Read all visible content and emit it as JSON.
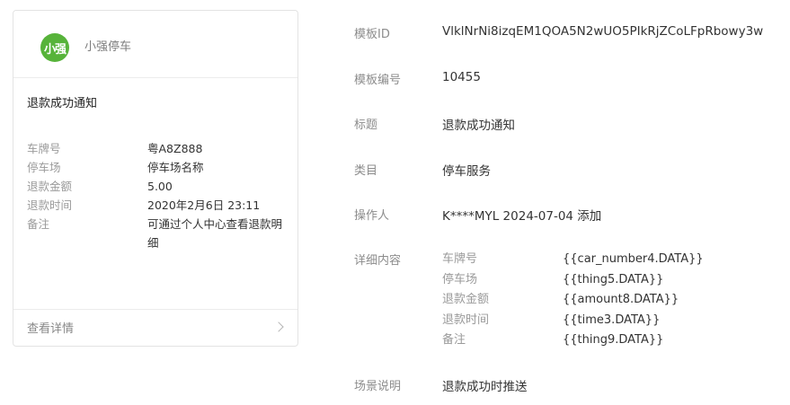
{
  "preview": {
    "brand_logo_text": "小强",
    "brand_name": "小强停车",
    "title": "退款成功通知",
    "fields": [
      {
        "label": "车牌号",
        "value": "粤A8Z888"
      },
      {
        "label": "停车场",
        "value": "停车场名称"
      },
      {
        "label": "退款金额",
        "value": "5.00"
      },
      {
        "label": "退款时间",
        "value": "2020年2月6日 23:11"
      },
      {
        "label": "备注",
        "value": "可通过个人中心查看退款明细"
      }
    ],
    "footer_link": "查看详情"
  },
  "info": {
    "template_id_label": "模板ID",
    "template_id": "VlklNrNi8izqEM1QOA5N2wUO5PIkRjZCoLFpRbowy3w",
    "template_no_label": "模板编号",
    "template_no": "10455",
    "title_label": "标题",
    "title": "退款成功通知",
    "category_label": "类目",
    "category": "停车服务",
    "operator_label": "操作人",
    "operator": "K****MYL 2024-07-04 添加",
    "details_label": "详细内容",
    "details": [
      {
        "label": "车牌号",
        "value": "{{car_number4.DATA}}"
      },
      {
        "label": "停车场",
        "value": "{{thing5.DATA}}"
      },
      {
        "label": "退款金额",
        "value": "{{amount8.DATA}}"
      },
      {
        "label": "退款时间",
        "value": "{{time3.DATA}}"
      },
      {
        "label": "备注",
        "value": "{{thing9.DATA}}"
      }
    ],
    "scene_label": "场景说明",
    "scene": "退款成功时推送"
  }
}
